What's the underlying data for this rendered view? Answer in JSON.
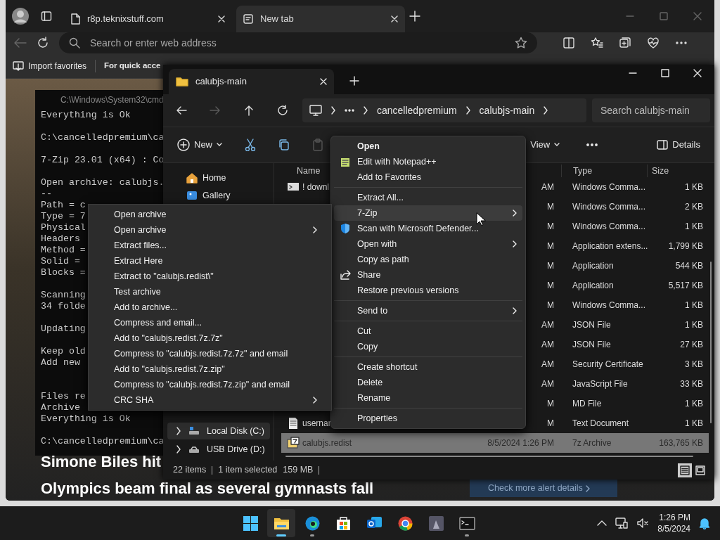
{
  "browser": {
    "tabs": [
      {
        "label": "r8p.teknixstuff.com",
        "selected": false
      },
      {
        "label": "New tab",
        "selected": true
      }
    ],
    "back_disabled": true,
    "address": {
      "placeholder": "Search or enter web address"
    },
    "favorites": [
      "Import favorites",
      "For quick acce"
    ],
    "headlines": [
      "Simone Biles hit",
      "Olympics beam final as several gymnasts fall"
    ],
    "alert_button": "Check more alert details"
  },
  "cmd": {
    "title": "C:\\Windows\\System32\\cmd",
    "blocks": [
      {
        "kind": "output",
        "lines": [
          "Everything is Ok"
        ]
      },
      {
        "kind": "output",
        "lines": [
          "C:\\cancelledpremium\\ca"
        ]
      },
      {
        "kind": "output",
        "lines": [
          "7-Zip 23.01 (x64) : Co"
        ]
      },
      {
        "kind": "output",
        "lines": [
          "Open archive: calubjs.",
          "--",
          "Path = c",
          "Type = 7",
          "Physical",
          "Headers",
          "Method =",
          "Solid =",
          "Blocks ="
        ]
      },
      {
        "kind": "output",
        "lines": [
          "Scanning",
          "34 folde"
        ]
      },
      {
        "kind": "output",
        "lines": [
          "Updating"
        ]
      },
      {
        "kind": "output",
        "lines": [
          "Keep old",
          "Add new"
        ]
      },
      {
        "kind": "after_progress",
        "lines": [
          "Files re",
          "Archive",
          "Everything is Ok"
        ]
      },
      {
        "kind": "output",
        "lines": [
          "C:\\cancelledpremium\\ca"
        ]
      }
    ]
  },
  "explorer": {
    "tab": "calubjs-main",
    "nav_buttons": [
      {
        "kind": "back",
        "disabled": false
      },
      {
        "kind": "forward",
        "disabled": true
      },
      {
        "kind": "up",
        "disabled": false
      },
      {
        "kind": "refresh",
        "disabled": false
      }
    ],
    "breadcrumb": [
      "cancelledpremium",
      "calubjs-main"
    ],
    "search": {
      "placeholder": "Search calubjs-main"
    },
    "new_button": "New",
    "tools": [
      {
        "kind": "cut",
        "disabled": false
      },
      {
        "kind": "copy",
        "disabled": false
      },
      {
        "kind": "paste",
        "disabled": true
      }
    ],
    "view_button": "View",
    "details_button": "Details",
    "nav_pane": [
      {
        "kind": "home",
        "label": "Home",
        "selected": false
      },
      {
        "kind": "gallery",
        "label": "Gallery",
        "selected": false
      },
      {
        "kind": "drive",
        "label": "Local Disk (C:)",
        "selected": true
      },
      {
        "kind": "usb",
        "label": "USB Drive (D:)",
        "selected": false
      }
    ],
    "columns": [
      "Name",
      "Type",
      "Size"
    ],
    "rows": [
      {
        "kind": "script",
        "name": "! downl",
        "date": "AM",
        "type": "Windows Comma...",
        "size": "1 KB",
        "selected": false
      },
      {
        "kind": "hidden",
        "date": "M",
        "type": "Windows Comma...",
        "size": "2 KB",
        "selected": false
      },
      {
        "kind": "hidden",
        "date": "M",
        "type": "Windows Comma...",
        "size": "1 KB",
        "selected": false
      },
      {
        "kind": "hidden",
        "date": "M",
        "type": "Application extens...",
        "size": "1,799 KB",
        "selected": false
      },
      {
        "kind": "hidden",
        "date": "M",
        "type": "Application",
        "size": "544 KB",
        "selected": false
      },
      {
        "kind": "hidden",
        "date": "M",
        "type": "Application",
        "size": "5,517 KB",
        "selected": false
      },
      {
        "kind": "hidden",
        "date": "M",
        "type": "Windows Comma...",
        "size": "1 KB",
        "selected": false
      },
      {
        "kind": "hidden",
        "date": "AM",
        "type": "JSON File",
        "size": "1 KB",
        "selected": false
      },
      {
        "kind": "hidden",
        "date": "AM",
        "type": "JSON File",
        "size": "27 KB",
        "selected": false
      },
      {
        "kind": "hidden",
        "date": "AM",
        "type": "Security Certificate",
        "size": "3 KB",
        "selected": false
      },
      {
        "kind": "hidden",
        "date": "AM",
        "type": "JavaScript File",
        "size": "33 KB",
        "selected": false
      },
      {
        "kind": "hidden",
        "date": "M",
        "type": "MD File",
        "size": "1 KB",
        "selected": false
      },
      {
        "kind": "text",
        "name": "usernar",
        "date": "M",
        "type": "Text Document",
        "size": "1 KB",
        "selected": false
      },
      {
        "kind": "archive",
        "name": "calubjs.redist",
        "date": "8/5/2024 1:26 PM",
        "type": "7z Archive",
        "size": "163,765 KB",
        "selected": true
      }
    ],
    "status": {
      "items": "22 items",
      "selected": "1 item selected",
      "size": "159 MB"
    },
    "views": [
      {
        "kind": "details",
        "selected": true
      },
      {
        "kind": "tiles",
        "selected": false
      }
    ]
  },
  "context_menu": [
    {
      "kind": "plain",
      "label": "Open",
      "bold": true,
      "submenu": false,
      "selected": false
    },
    {
      "kind": "notepad",
      "label": "Edit with Notepad++",
      "bold": false,
      "submenu": false,
      "selected": false
    },
    {
      "kind": "plain",
      "label": "Add to Favorites",
      "bold": false,
      "submenu": false,
      "selected": false
    },
    {
      "kind": "separator"
    },
    {
      "kind": "plain",
      "label": "Extract All...",
      "bold": false,
      "submenu": false,
      "selected": false
    },
    {
      "kind": "plain",
      "label": "7-Zip",
      "bold": false,
      "submenu": true,
      "selected": true
    },
    {
      "kind": "shield",
      "label": "Scan with Microsoft Defender...",
      "bold": false,
      "submenu": false,
      "selected": false
    },
    {
      "kind": "plain",
      "label": "Open with",
      "bold": false,
      "submenu": true,
      "selected": false
    },
    {
      "kind": "plain",
      "label": "Copy as path",
      "bold": false,
      "submenu": false,
      "selected": false
    },
    {
      "kind": "share",
      "label": "Share",
      "bold": false,
      "submenu": false,
      "selected": false
    },
    {
      "kind": "plain",
      "label": "Restore previous versions",
      "bold": false,
      "submenu": false,
      "selected": false
    },
    {
      "kind": "separator"
    },
    {
      "kind": "plain",
      "label": "Send to",
      "bold": false,
      "submenu": true,
      "selected": false
    },
    {
      "kind": "separator"
    },
    {
      "kind": "plain",
      "label": "Cut",
      "bold": false,
      "submenu": false,
      "selected": false
    },
    {
      "kind": "plain",
      "label": "Copy",
      "bold": false,
      "submenu": false,
      "selected": false
    },
    {
      "kind": "separator"
    },
    {
      "kind": "plain",
      "label": "Create shortcut",
      "bold": false,
      "submenu": false,
      "selected": false
    },
    {
      "kind": "plain",
      "label": "Delete",
      "bold": false,
      "submenu": false,
      "selected": false
    },
    {
      "kind": "plain",
      "label": "Rename",
      "bold": false,
      "submenu": false,
      "selected": false
    },
    {
      "kind": "separator"
    },
    {
      "kind": "plain",
      "label": "Properties",
      "bold": false,
      "submenu": false,
      "selected": false
    }
  ],
  "zip_submenu": [
    {
      "label": "Open archive",
      "submenu": false
    },
    {
      "label": "Open archive",
      "submenu": true
    },
    {
      "label": "Extract files...",
      "submenu": false
    },
    {
      "label": "Extract Here",
      "submenu": false
    },
    {
      "label": "Extract to \"calubjs.redist\\\"",
      "submenu": false
    },
    {
      "label": "Test archive",
      "submenu": false
    },
    {
      "label": "Add to archive...",
      "submenu": false
    },
    {
      "label": "Compress and email...",
      "submenu": false
    },
    {
      "label": "Add to \"calubjs.redist.7z.7z\"",
      "submenu": false
    },
    {
      "label": "Compress to \"calubjs.redist.7z.7z\" and email",
      "submenu": false
    },
    {
      "label": "Add to \"calubjs.redist.7z.zip\"",
      "submenu": false
    },
    {
      "label": "Compress to \"calubjs.redist.7z.zip\" and email",
      "submenu": false
    },
    {
      "label": "CRC SHA",
      "submenu": true
    }
  ],
  "taskbar": {
    "apps": [
      {
        "kind": "start",
        "active": false,
        "running": false
      },
      {
        "kind": "explorer",
        "active": true,
        "running": true
      },
      {
        "kind": "edge",
        "active": false,
        "running": true
      },
      {
        "kind": "store",
        "active": false,
        "running": false
      },
      {
        "kind": "mail",
        "active": false,
        "running": false
      },
      {
        "kind": "chrome",
        "active": false,
        "running": false
      },
      {
        "kind": "game",
        "active": false,
        "running": false
      },
      {
        "kind": "terminal",
        "active": false,
        "running": true
      }
    ],
    "time": "1:26 PM",
    "date": "8/5/2024"
  }
}
